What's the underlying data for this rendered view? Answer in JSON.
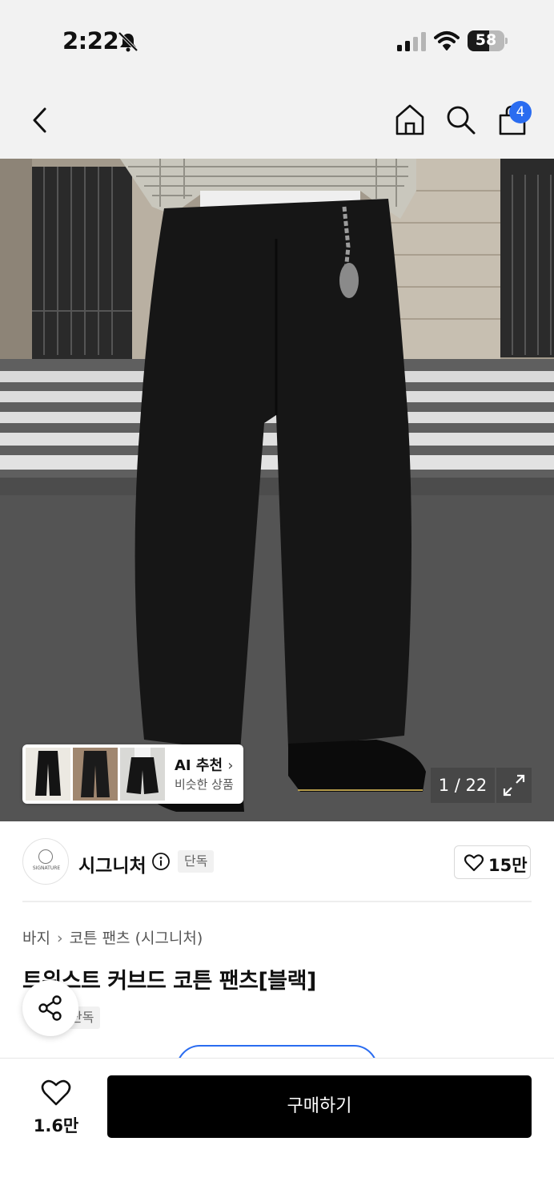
{
  "status_bar": {
    "time": "2:22",
    "battery": "58",
    "battery_level_percent": 58,
    "icons": [
      "bell-slash-icon",
      "cellular-signal-icon",
      "wifi-icon",
      "battery-icon"
    ]
  },
  "nav": {
    "icons": [
      "back-chevron-icon",
      "home-icon",
      "search-icon",
      "shopping-bag-icon"
    ],
    "cart_count": "4",
    "badge_color": "#2a6cf0"
  },
  "gallery": {
    "ai_title": "AI 추천",
    "ai_subtitle": "비슷한 상품",
    "counter": "1 / 22"
  },
  "brand": {
    "logo_text": "SIGNATURE",
    "name": "시그니처",
    "tag": "단독",
    "likes": "15만"
  },
  "product": {
    "breadcrumb": [
      "바지",
      "코튼 팬츠 (시그니처)"
    ],
    "title": "트위스트 커브드 코튼 팬츠[블랙]",
    "tag": "단독"
  },
  "bottom_bar": {
    "wish_count": "1.6만",
    "buy_label": "구매하기"
  },
  "colors": {
    "accent": "#2a6cf0",
    "buy_button": "#000000"
  }
}
